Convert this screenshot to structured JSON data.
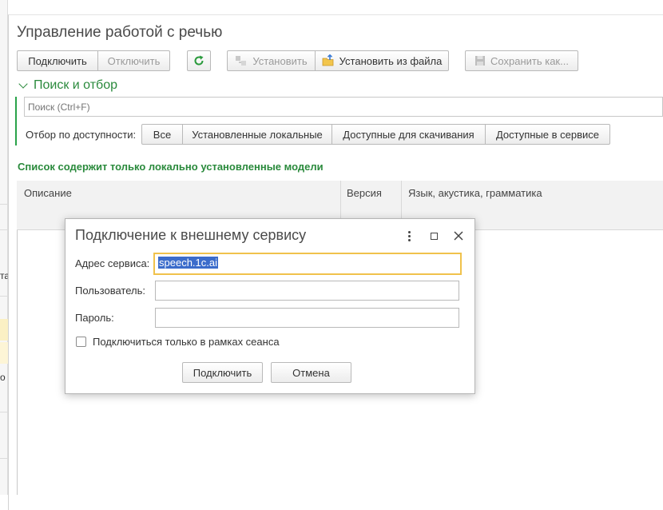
{
  "window": {
    "title": "Управление работой с речью"
  },
  "background_fragments": [
    "та",
    "о"
  ],
  "toolbar": {
    "connect": "Подключить",
    "disconnect": "Отключить",
    "install": "Установить",
    "install_from_file": "Установить из файла",
    "save_as": "Сохранить как..."
  },
  "search_section": {
    "title": "Поиск и отбор",
    "search_placeholder": "Поиск (Ctrl+F)",
    "filter_label": "Отбор по доступности:",
    "filters": [
      "Все",
      "Установленные локальные",
      "Доступные для скачивания",
      "Доступные в сервисе"
    ]
  },
  "list_note": "Список содержит только локально установленные модели",
  "table": {
    "columns": [
      "Описание",
      "Версия",
      "Язык, акустика, грамматика"
    ]
  },
  "dialog": {
    "title": "Подключение к внешнему сервису",
    "address_label": "Адрес сервиса:",
    "address_value": "speech.1c.ai",
    "user_label": "Пользователь:",
    "user_value": "",
    "password_label": "Пароль:",
    "password_value": "",
    "session_only_label": "Подключиться только в рамках сеанса",
    "session_only_checked": false,
    "connect_button": "Подключить",
    "cancel_button": "Отмена"
  },
  "colors": {
    "accent_green": "#2a8a3c",
    "focus_yellow": "#f0c24c",
    "selection_blue": "#3b6ccb"
  }
}
